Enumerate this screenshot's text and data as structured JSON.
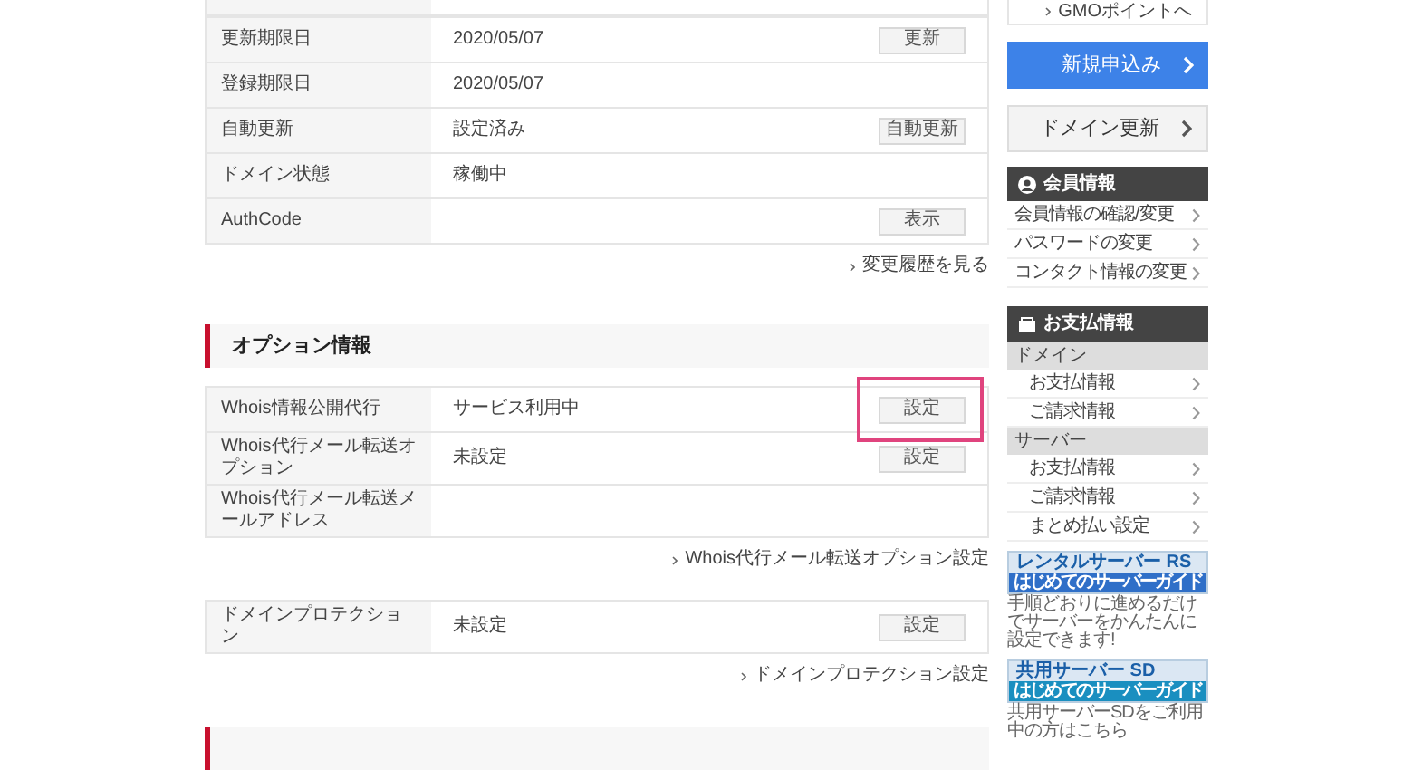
{
  "domain_table": {
    "rows": [
      {
        "label": "更新期限日",
        "value": "2020/05/07",
        "button": "更新"
      },
      {
        "label": "登録期限日",
        "value": "2020/05/07"
      },
      {
        "label": "自動更新",
        "value": "設定済み",
        "button": "自動更新"
      },
      {
        "label": "ドメイン状態",
        "value": "稼働中"
      },
      {
        "label": "AuthCode",
        "button": "表示"
      }
    ],
    "link": "変更履歴を見る"
  },
  "option_section": {
    "title": "オプション情報",
    "rows": [
      {
        "label": "Whois情報公開代行",
        "value": "サービス利用中",
        "button": "設定",
        "highlighted": true
      },
      {
        "label": "Whois代行メール転送オプション",
        "value": "未設定",
        "button": "設定",
        "highlighted": false
      },
      {
        "label": "Whois代行メール転送メールアドレス"
      }
    ],
    "link": "Whois代行メール転送オプション設定"
  },
  "protection": {
    "rows": [
      {
        "label": "ドメインプロテクション",
        "value": "未設定",
        "button": "設定"
      }
    ],
    "link": "ドメインプロテクション設定"
  },
  "sidebar": {
    "points_link": "GMOポイントへ",
    "buttons": [
      {
        "label": "新規申込み",
        "kind": "primary"
      },
      {
        "label": "ドメイン更新",
        "kind": "secondary"
      }
    ],
    "member": {
      "title": "会員情報",
      "items": [
        "会員情報の確認/変更",
        "パスワードの変更",
        "コンタクト情報の変更"
      ]
    },
    "payment": {
      "title": "お支払情報",
      "groups": [
        {
          "title": "ドメイン",
          "items": [
            "お支払情報",
            "ご請求情報"
          ]
        },
        {
          "title": "サーバー",
          "items": [
            "お支払情報",
            "ご請求情報",
            "まとめ払い設定"
          ]
        }
      ]
    },
    "banners": [
      {
        "title": "レンタルサーバー RS",
        "subtitle": "はじめてのサーバーガイド",
        "caption": "手順どおりに進めるだけでサーバーをかんたんに設定できます!"
      },
      {
        "title": "共用サーバー SD",
        "subtitle": "はじめてのサーバーガイド",
        "caption": "共用サーバーSDをご利用中の方はこちら"
      }
    ]
  }
}
